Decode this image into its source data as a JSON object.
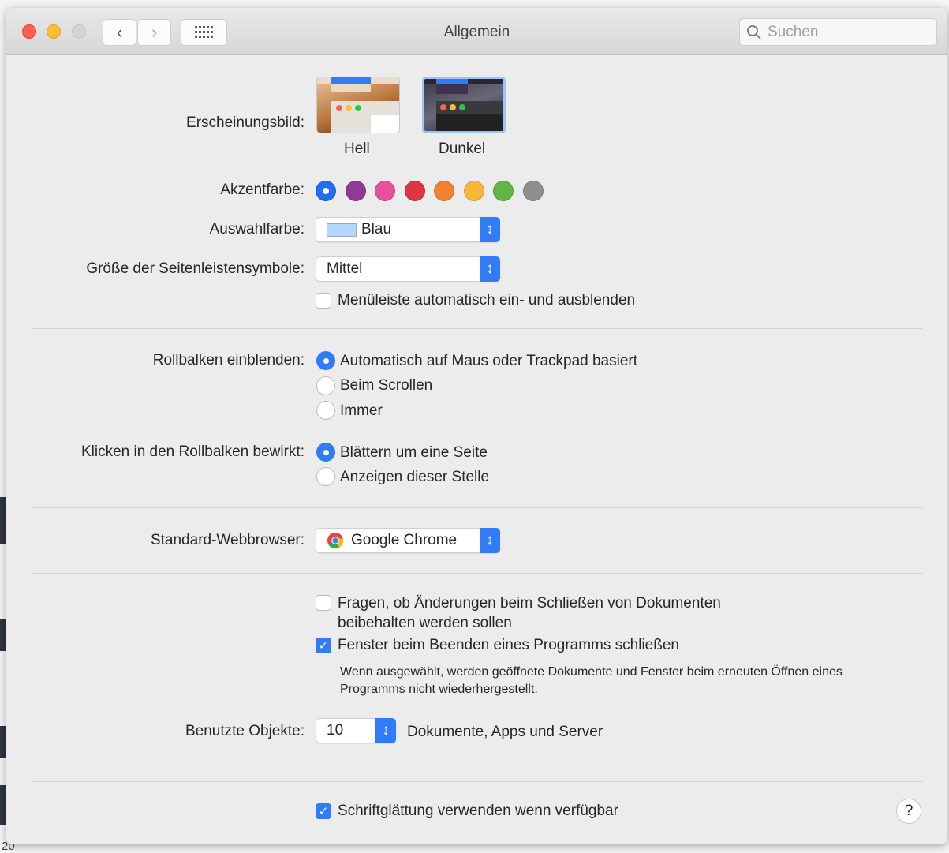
{
  "window": {
    "title": "Allgemein",
    "search_placeholder": "Suchen"
  },
  "appearance": {
    "label": "Erscheinungsbild:",
    "options": [
      {
        "label": "Hell"
      },
      {
        "label": "Dunkel",
        "selected": true
      }
    ]
  },
  "accent": {
    "label": "Akzentfarbe:",
    "colors": [
      "#1f6ff0",
      "#8d3b97",
      "#ea4f9c",
      "#de3540",
      "#ef8230",
      "#f8b73b",
      "#63b546",
      "#8f8f8f"
    ],
    "selected_index": 0
  },
  "highlight": {
    "label": "Auswahlfarbe:",
    "value": "Blau",
    "swatch": "#b3d7ff"
  },
  "sidebar_size": {
    "label": "Größe der Seitenleistensymbole:",
    "value": "Mittel"
  },
  "menubar": {
    "label": "Menüleiste automatisch ein- und ausblenden",
    "checked": false
  },
  "scrollbars": {
    "label": "Rollbalken einblenden:",
    "options": [
      "Automatisch auf Maus oder Trackpad basiert",
      "Beim Scrollen",
      "Immer"
    ],
    "selected_index": 0
  },
  "scroll_click": {
    "label": "Klicken in den Rollbalken bewirkt:",
    "options": [
      "Blättern um eine Seite",
      "Anzeigen dieser Stelle"
    ],
    "selected_index": 0
  },
  "browser": {
    "label": "Standard-Webbrowser:",
    "value": "Google Chrome"
  },
  "ask_changes": {
    "label_line1": "Fragen, ob Änderungen beim Schließen von Dokumenten",
    "label_line2": "beibehalten werden sollen",
    "checked": false
  },
  "close_windows": {
    "label": "Fenster beim Beenden eines Programms schließen",
    "checked": true,
    "note_line1": "Wenn ausgewählt, werden geöffnete Dokumente und Fenster beim erneuten Öffnen eines",
    "note_line2": "Programms nicht wiederhergestellt."
  },
  "recent": {
    "label": "Benutzte Objekte:",
    "value": "10",
    "suffix": "Dokumente, Apps und Server"
  },
  "font_smoothing": {
    "label": "Schriftglättung verwenden wenn verfügbar",
    "checked": true
  },
  "help": "?",
  "background_text": "20"
}
